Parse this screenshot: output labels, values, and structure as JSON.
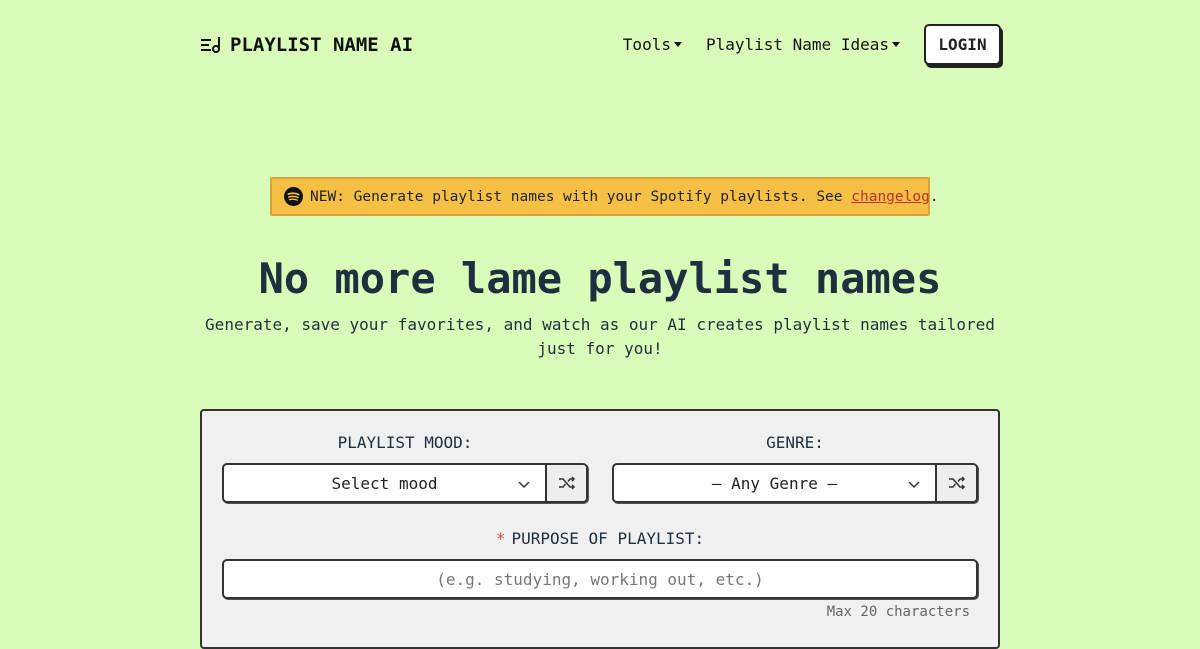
{
  "nav": {
    "brand": "PLAYLIST NAME AI",
    "brand_icon": "playlist-music-icon",
    "links": [
      {
        "label": "Tools",
        "has_dropdown": true
      },
      {
        "label": "Playlist Name Ideas",
        "has_dropdown": true
      }
    ],
    "login_label": "LOGIN"
  },
  "banner": {
    "icon": "spotify-icon",
    "text": "NEW: Generate playlist names with your Spotify playlists. See ",
    "link_label": "changelog",
    "suffix": ".",
    "background": "#f5c043",
    "link_color": "#c0302a"
  },
  "hero": {
    "title": "No more lame playlist names",
    "subtitle": "Generate, save your favorites, and watch as our AI creates playlist names tailored just for you!"
  },
  "form": {
    "mood": {
      "label": "PLAYLIST MOOD:",
      "selected": "Select mood",
      "shuffle_icon": "shuffle-icon"
    },
    "genre": {
      "label": "GENRE:",
      "selected": "– Any Genre –",
      "shuffle_icon": "shuffle-icon"
    },
    "purpose": {
      "required_marker": "*",
      "label": "PURPOSE OF PLAYLIST:",
      "value": "",
      "placeholder": "(e.g. studying, working out, etc.)",
      "hint": "Max 20 characters"
    }
  },
  "colors": {
    "page_background": "#d9fdb9",
    "card_background": "#f0f0f0",
    "text_dark": "#1e2f3f",
    "required": "#e04b4b"
  }
}
